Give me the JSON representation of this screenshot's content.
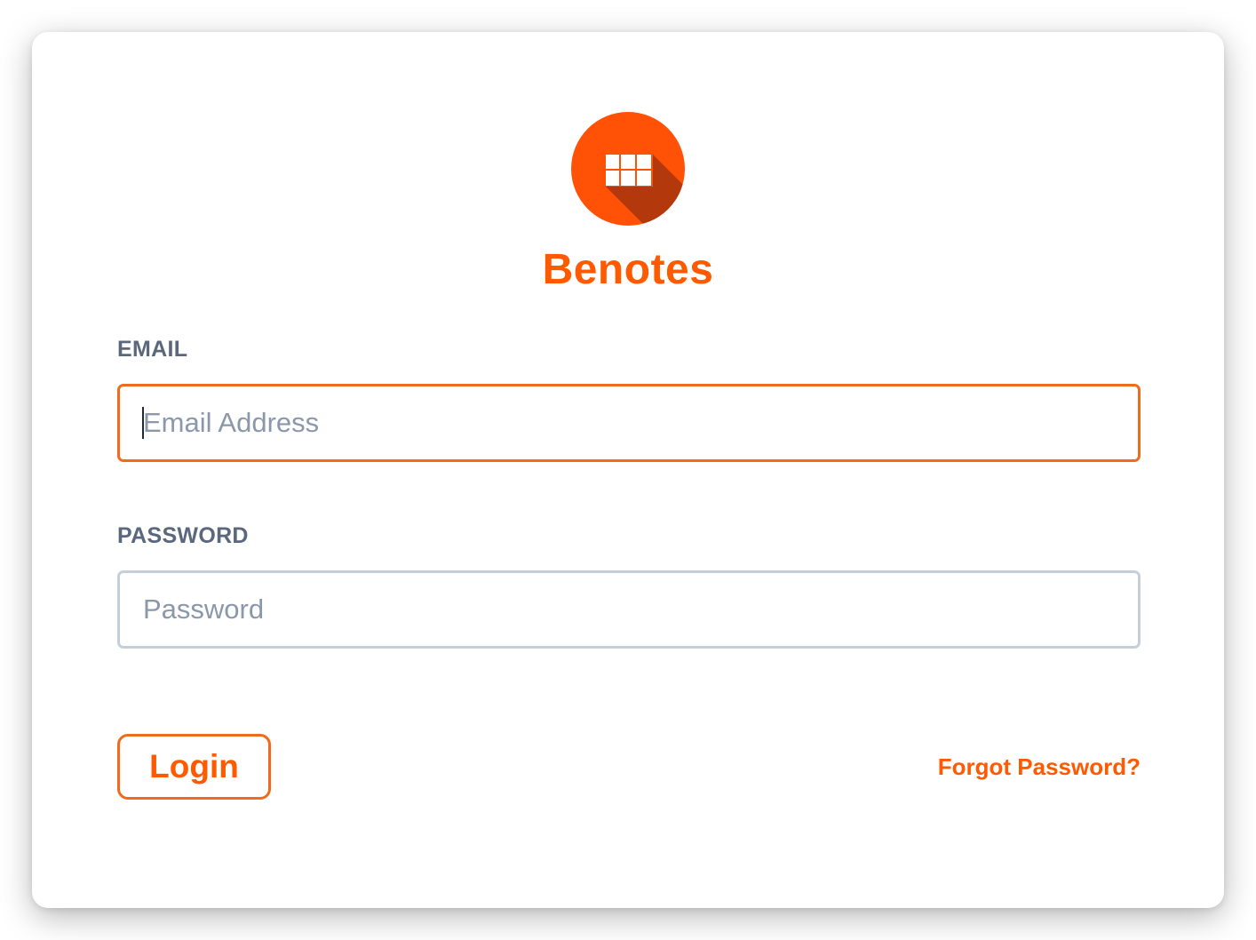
{
  "brand": {
    "name": "Benotes",
    "logo_icon": "grid-icon",
    "accent_color": "#ff5a00"
  },
  "form": {
    "email_label": "EMAIL",
    "email_placeholder": "Email Address",
    "email_value": "",
    "password_label": "PASSWORD",
    "password_placeholder": "Password",
    "password_value": ""
  },
  "actions": {
    "login_label": "Login",
    "forgot_password_label": "Forgot Password?"
  }
}
